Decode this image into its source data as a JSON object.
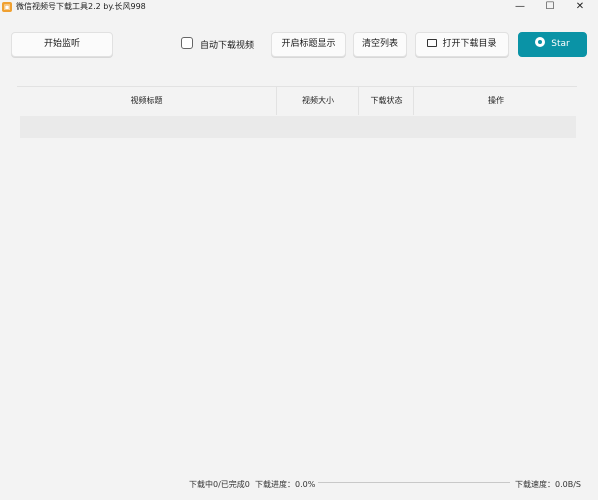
{
  "window": {
    "title": "微信视频号下载工具2.2 by.长风998",
    "minimize_glyph": "—",
    "maximize_glyph": "☐",
    "close_glyph": "✕"
  },
  "toolbar": {
    "start_label": "开始监听",
    "auto_download_label": "自动下载视频",
    "auto_download_checked": false,
    "show_titles_label": "开启标题显示",
    "clear_label": "清空列表",
    "open_dir_label": "打开下载目录",
    "star_label": "Star"
  },
  "table": {
    "columns": [
      "视频标题",
      "视频大小",
      "下载状态",
      "操作"
    ],
    "rows": []
  },
  "status": {
    "counts_text": "下载中0/已完成0",
    "progress_text": "下载进度：0.0%",
    "progress_fraction": 0.0,
    "speed_text": "下载速度：0.0B/S"
  },
  "colors": {
    "accent": "#0a93a6",
    "app_icon": "#f0a030"
  }
}
